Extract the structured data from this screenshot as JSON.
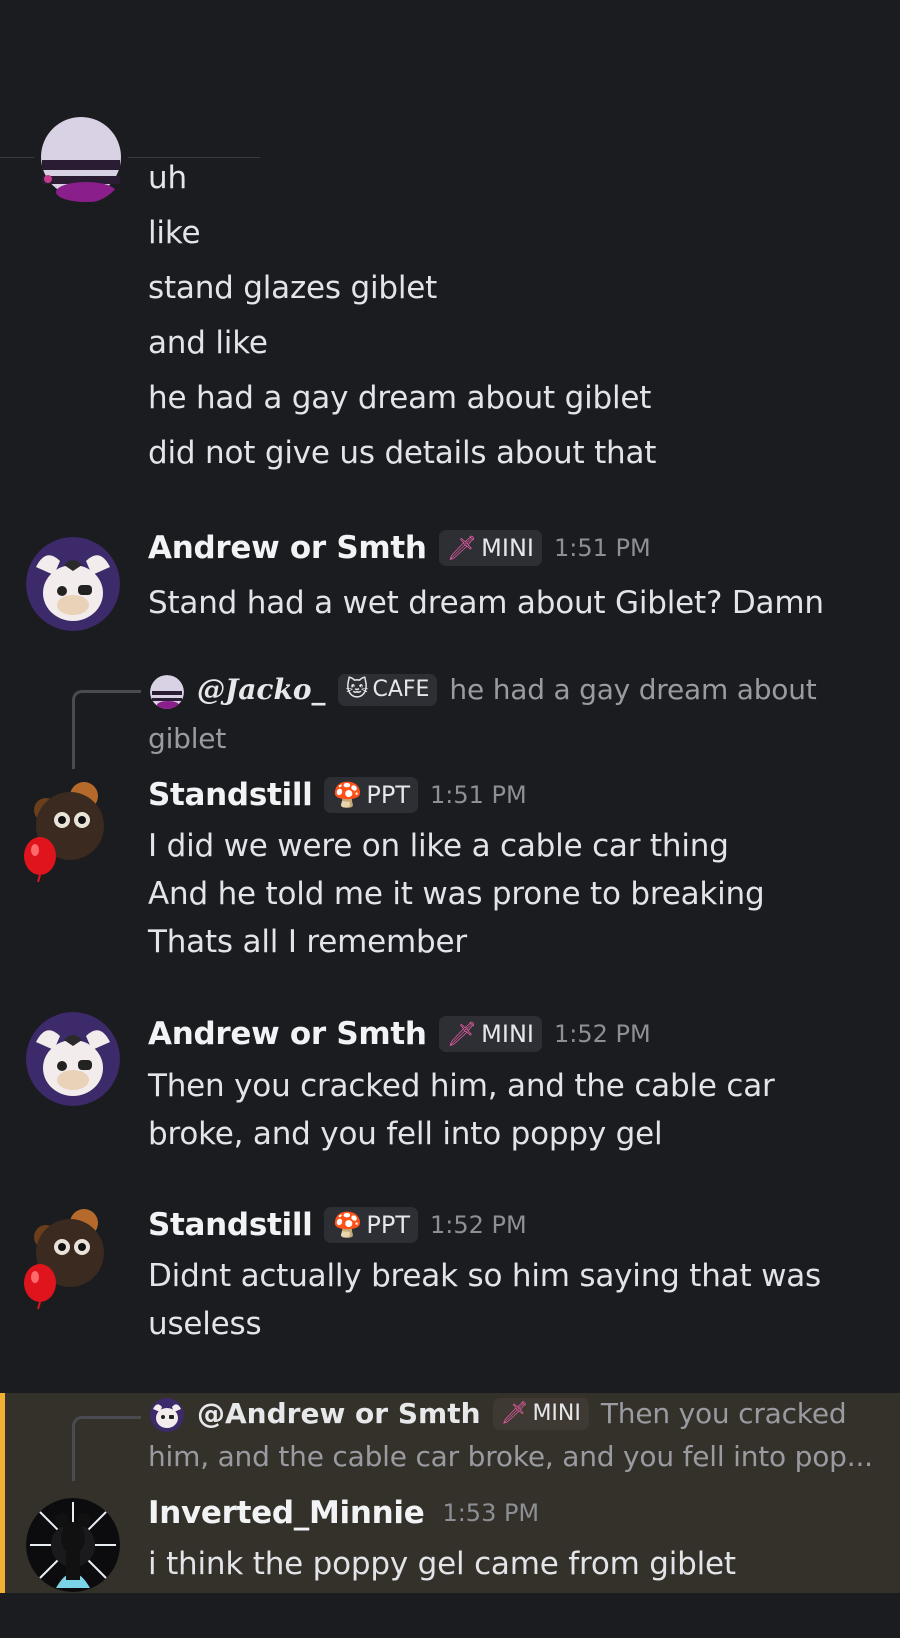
{
  "messages": {
    "continued": {
      "lines": [
        "uh",
        "like",
        "stand glazes giblet",
        "and like",
        "he had a gay dream about giblet",
        "did not give us details about that"
      ]
    },
    "m1": {
      "author": "Andrew or Smth",
      "tag": "MINI",
      "time": "1:51 PM",
      "lines": [
        "Stand had a wet dream about Giblet? Damn"
      ]
    },
    "m2": {
      "reply": {
        "author": "@Jacko_",
        "tag": "CAFE",
        "text_1": "he had a gay dream about",
        "text_2": "giblet"
      },
      "author": "Standstill",
      "tag": "PPT",
      "time": "1:51 PM",
      "lines": [
        "I did we were on like a cable car thing",
        "And he told me it was prone to breaking",
        "Thats all I remember"
      ]
    },
    "m3": {
      "author": "Andrew or Smth",
      "tag": "MINI",
      "time": "1:52 PM",
      "lines": [
        "Then you cracked him, and the cable car",
        "broke, and you fell into poppy gel"
      ]
    },
    "m4": {
      "author": "Standstill",
      "tag": "PPT",
      "time": "1:52 PM",
      "lines": [
        "Didnt actually break so him saying that was",
        "useless"
      ]
    },
    "m5": {
      "reply": {
        "author": "@Andrew or Smth",
        "tag": "MINI",
        "text_1": "Then you cracked",
        "text_2": "him, and the cable car broke, and you fell into pop..."
      },
      "author": "Inverted_Minnie",
      "time": "1:53 PM",
      "lines": [
        "i think the poppy gel came from giblet"
      ]
    }
  },
  "icons": {
    "mini": "sword-icon",
    "cafe": "cat-icon",
    "ppt": "mushroom-icon"
  },
  "colors": {
    "background": "#1b1c20",
    "mention_highlight": "#34302a",
    "mention_bar": "#f0b132",
    "tag_bg": "#2e2f35"
  }
}
